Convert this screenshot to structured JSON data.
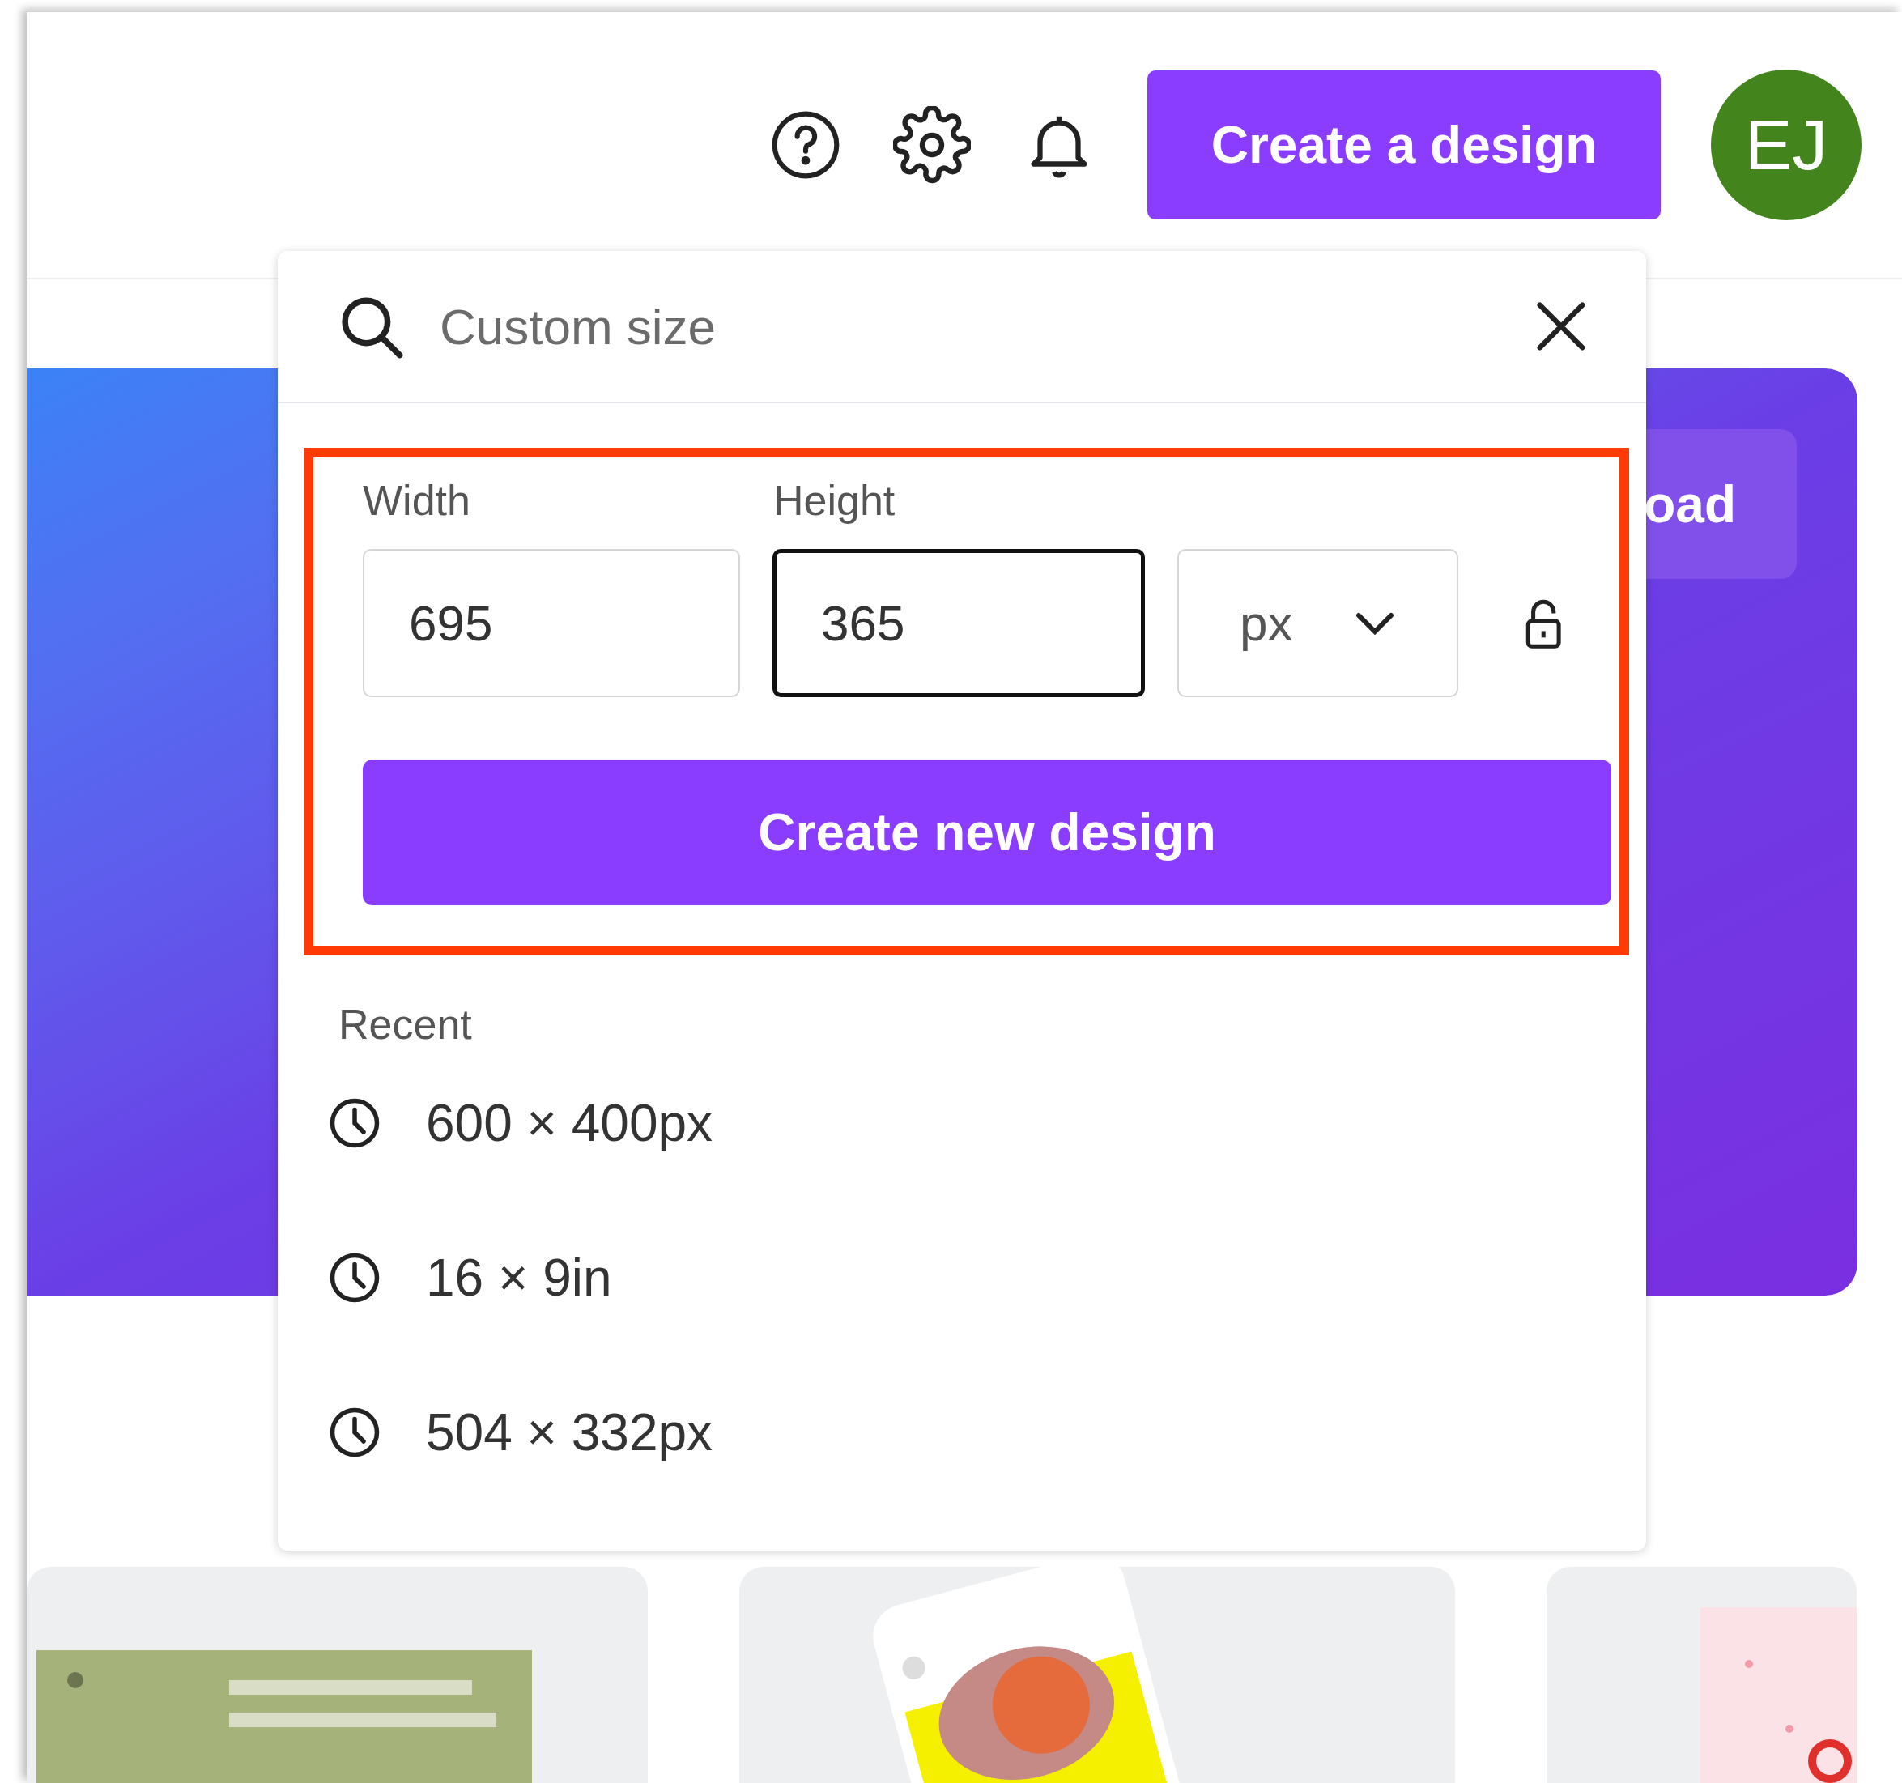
{
  "header": {
    "create_button": "Create a design",
    "avatar": "EJ"
  },
  "banner": {
    "button": "oad"
  },
  "popup": {
    "search": {
      "placeholder": "Custom size"
    },
    "custom_size": {
      "width_label": "Width",
      "height_label": "Height",
      "width": {
        "value": "695",
        "focused": false
      },
      "height": {
        "value": "365",
        "focused": true
      },
      "unit": "px",
      "create_button": "Create new design"
    },
    "recent_label": "Recent",
    "recent": [
      {
        "label": "600 × 400px"
      },
      {
        "label": "16 × 9in"
      },
      {
        "label": "504 × 332px"
      }
    ]
  }
}
